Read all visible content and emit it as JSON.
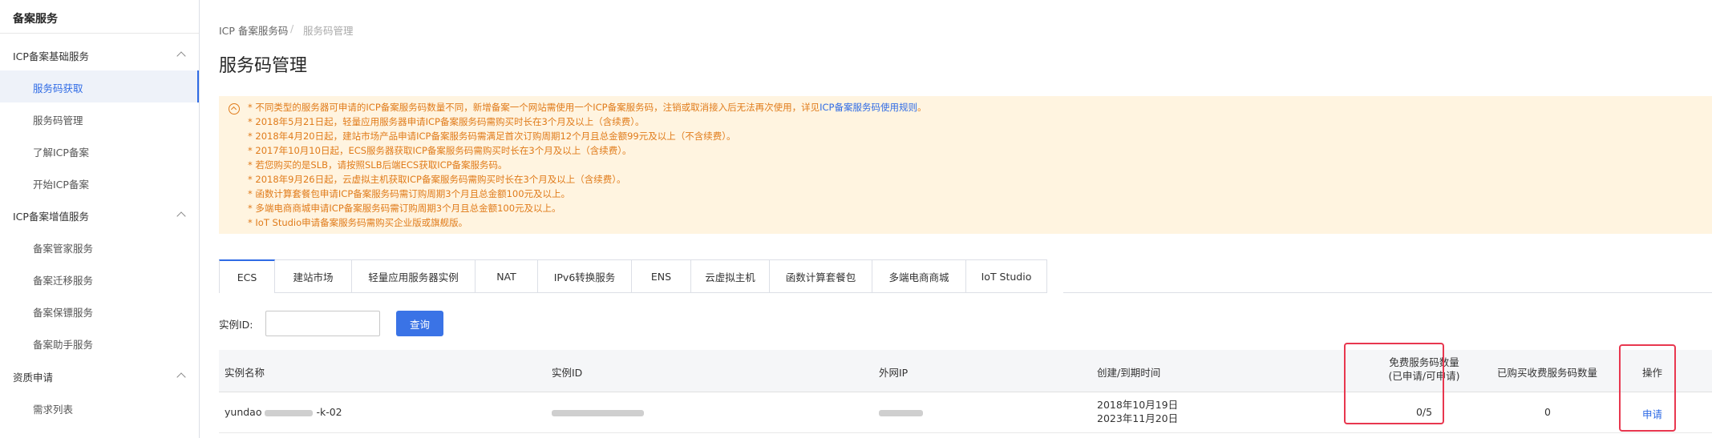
{
  "sidebar": {
    "title": "备案服务",
    "groups": [
      {
        "label": "ICP备案基础服务",
        "items": [
          "服务码获取",
          "服务码管理",
          "了解ICP备案",
          "开始ICP备案"
        ]
      },
      {
        "label": "ICP备案增值服务",
        "items": [
          "备案管家服务",
          "备案迁移服务",
          "备案保镖服务",
          "备案助手服务"
        ]
      },
      {
        "label": "资质申请",
        "items": [
          "需求列表"
        ]
      }
    ],
    "active_item": "服务码获取"
  },
  "breadcrumb": {
    "parent": "ICP 备案服务码",
    "separator": "/",
    "current": "服务码管理"
  },
  "page_title": "服务码管理",
  "notice": {
    "line1_prefix": "* 不同类型的服务器可申请的ICP备案服务码数量不同，新增备案一个网站需使用一个ICP备案服务码，注销或取消接入后无法再次使用，详见",
    "line1_link": "ICP备案服务码使用规则",
    "line1_suffix": "。",
    "lines": [
      "* 2018年5月21日起，轻量应用服务器申请ICP备案服务码需购买时长在3个月及以上（含续费）。",
      "* 2018年4月20日起，建站市场产品申请ICP备案服务码需满足首次订购周期12个月且总金额99元及以上（不含续费）。",
      "* 2017年10月10日起，ECS服务器获取ICP备案服务码需购买时长在3个月及以上（含续费）。",
      "* 若您购买的是SLB，请按照SLB后端ECS获取ICP备案服务码。",
      "* 2018年9月26日起，云虚拟主机获取ICP备案服务码需购买时长在3个月及以上（含续费）。",
      "* 函数计算套餐包申请ICP备案服务码需订购周期3个月且总金额100元及以上。",
      "* 多端电商商城申请ICP备案服务码需订购周期3个月且总金额100元及以上。",
      "* IoT Studio申请备案服务码需购买企业版或旗舰版。"
    ]
  },
  "tabs": [
    "ECS",
    "建站市场",
    "轻量应用服务器实例",
    "NAT",
    "IPv6转换服务",
    "ENS",
    "云虚拟主机",
    "函数计算套餐包",
    "多端电商商城",
    "IoT Studio"
  ],
  "active_tab": "ECS",
  "filter": {
    "label": "实例ID:",
    "placeholder": "",
    "button": "查询"
  },
  "table": {
    "headers": {
      "name": "实例名称",
      "id": "实例ID",
      "ip": "外网IP",
      "dates": "创建/到期时间",
      "free_line1": "免费服务码数量",
      "free_line2": "(已申请/可申请)",
      "paid": "已购买收费服务码数量",
      "action": "操作"
    },
    "rows": [
      {
        "name_prefix": "yundao",
        "name_suffix": "-k-02",
        "created": "2018年10月19日",
        "expires": "2023年11月20日",
        "free": "0/5",
        "paid": "0",
        "action": "申请"
      }
    ]
  },
  "colors": {
    "accent": "#2f6be5",
    "notice_text": "#e07b1a",
    "notice_bg": "#fff4e0",
    "highlight": "#e8374f"
  }
}
